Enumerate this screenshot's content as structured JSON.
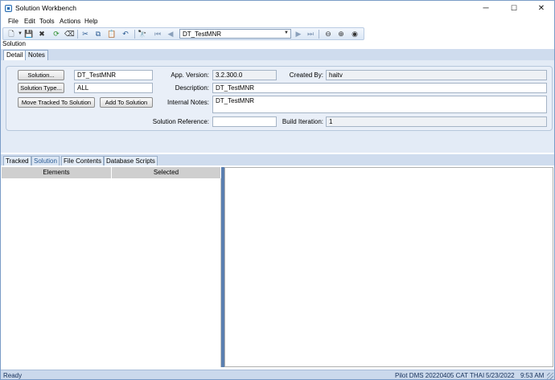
{
  "window": {
    "title": "Solution Workbench",
    "min_glyph": "─",
    "max_glyph": "☐",
    "close_glyph": "✕"
  },
  "menu": [
    "File",
    "Edit",
    "Tools",
    "Actions",
    "Help"
  ],
  "toolbar": {
    "solution_combo_value": "DT_TestMNR",
    "combo_arrow": "▼",
    "icons": {
      "new": "🗋",
      "save": "💾",
      "delete": "✖",
      "refresh": "⟳",
      "clear": "⌫",
      "cut": "✂",
      "copy": "⧉",
      "paste": "📋",
      "undo": "↶",
      "find": "🔭",
      "first": "⏮",
      "prev": "◀",
      "next": "▶",
      "last": "⏭",
      "back": "⊖",
      "forward": "⊕",
      "stop": "◉"
    }
  },
  "section_label": "Solution",
  "tabs": [
    "Detail",
    "Notes"
  ],
  "detail": {
    "solution_button": "Solution...",
    "solution_value": "DT_TestMNR",
    "solution_type_button": "Solution Type...",
    "solution_type_value": "ALL",
    "move_tracked_button": "Move Tracked To Solution",
    "add_to_solution_button": "Add To Solution",
    "app_version_label": "App. Version:",
    "app_version_value": "3.2.300.0",
    "created_by_label": "Created By:",
    "created_by_value": "haitv",
    "description_label": "Description:",
    "description_value": "DT_TestMNR",
    "internal_notes_label": "Internal Notes:",
    "internal_notes_value": "DT_TestMNR",
    "solution_reference_label": "Solution Reference:",
    "solution_reference_value": "",
    "build_iteration_label": "Build Iteration:",
    "build_iteration_value": "1"
  },
  "bottom_tabs": [
    "Tracked",
    "Solution",
    "File Contents",
    "Database Scripts"
  ],
  "grid": {
    "columns": [
      "Elements",
      "Selected"
    ]
  },
  "status": {
    "left": "Ready",
    "environment": "Pilot DMS 20220405 CAT THAI",
    "date": "5/23/2022",
    "time": "9:53 AM"
  }
}
